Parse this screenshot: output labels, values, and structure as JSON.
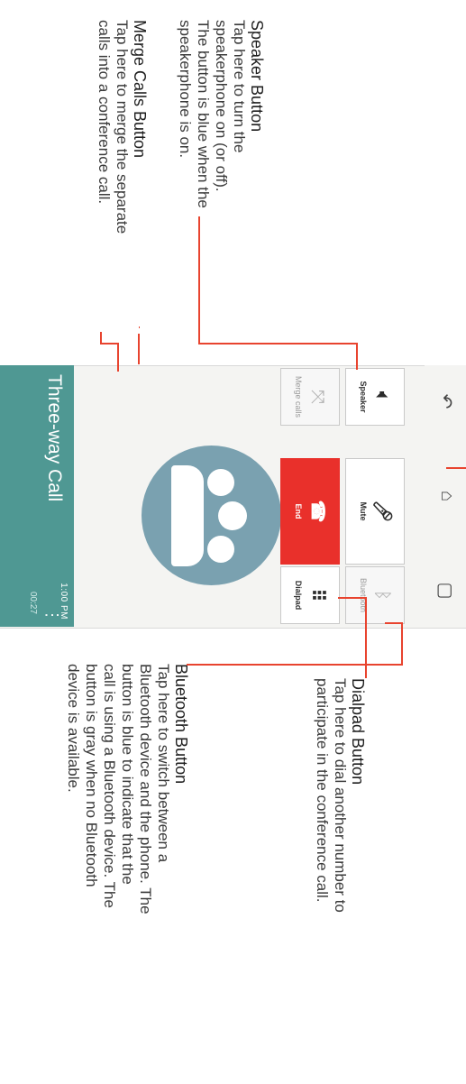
{
  "callouts": {
    "merge": {
      "title": "Merge Calls Button",
      "lines": [
        "Tap here to merge the separate",
        "calls into a conference call."
      ]
    },
    "speaker": {
      "title": "Speaker Button",
      "lines": [
        "Tap here to turn the",
        "speakerphone on (or off).",
        "The button is blue when the",
        "speakerphone is on."
      ]
    },
    "dialpad": {
      "title": "Dialpad Button",
      "lines": [
        "Tap here to dial another number to",
        "participate in the conference call."
      ]
    },
    "bluetooth": {
      "title": "Bluetooth Button",
      "lines": [
        "Tap here to switch between a",
        "Bluetooth device and the phone. The",
        "button is blue to indicate that the",
        "call is using a Bluetooth device. The",
        "button is gray when no Bluetooth",
        "device is available."
      ]
    }
  },
  "phone": {
    "title": "Three-way Call",
    "status": "1:00 PM",
    "timer": "00:27",
    "buttons": {
      "merge": "Merge calls",
      "end": "End",
      "dialpad": "Dialpad",
      "speaker": "Speaker",
      "mute": "Mute",
      "bluetooth": "Bluetooth"
    }
  },
  "icons": [
    "merge-icon",
    "end-call-icon",
    "dialpad-icon",
    "speaker-icon",
    "mute-icon",
    "bluetooth-icon",
    "back-icon",
    "home-icon",
    "recent-apps-icon",
    "overflow-menu-icon"
  ],
  "colors": {
    "header": "#4f9893",
    "end_button": "#e9302b",
    "leader_line": "#e8442f",
    "avatar": "#7aa1b0"
  }
}
